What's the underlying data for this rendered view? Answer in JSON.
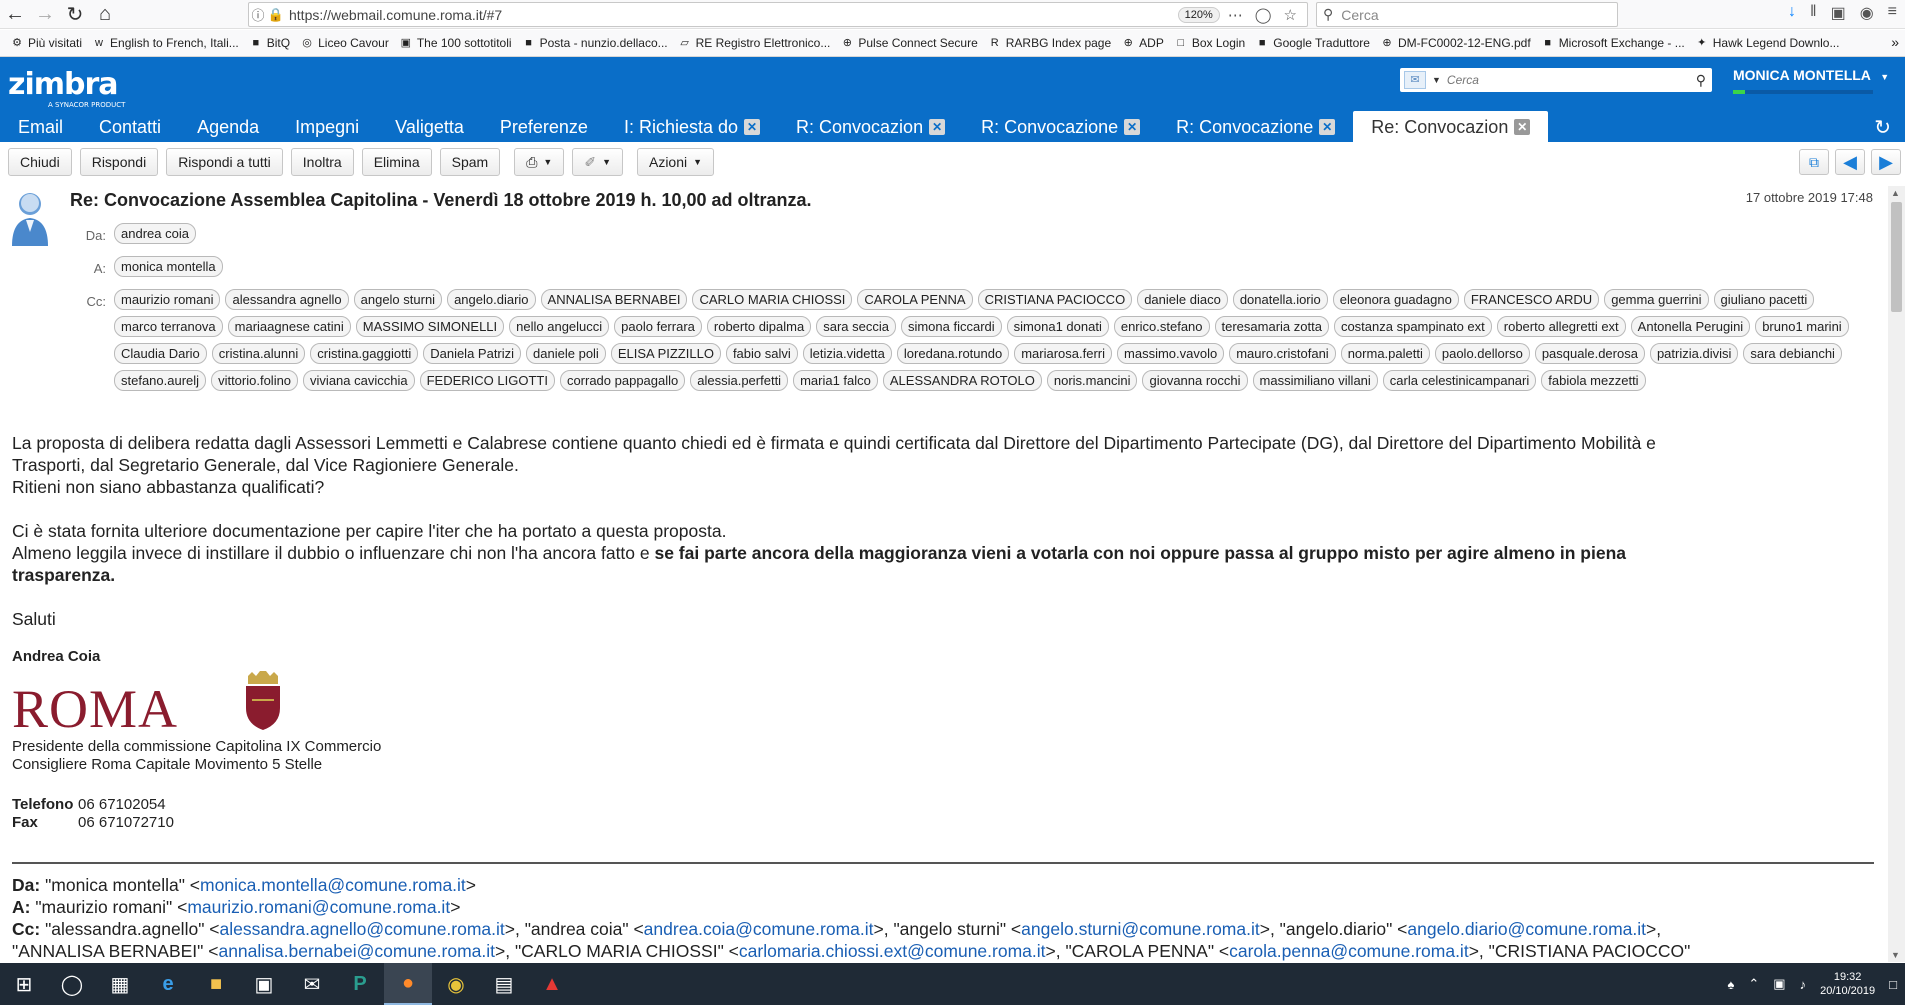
{
  "browser": {
    "url": "https://webmail.comune.roma.it/#7",
    "zoom": "120%",
    "search_placeholder": "Cerca",
    "bookmarks": [
      {
        "label": "Più visitati",
        "icon": "gear-icon"
      },
      {
        "label": "English to French, Itali...",
        "icon": "wr-icon"
      },
      {
        "label": "BitQ",
        "icon": "bitq-icon"
      },
      {
        "label": "Liceo Cavour",
        "icon": "school-icon"
      },
      {
        "label": "The 100 sottotitoli",
        "icon": "film-icon"
      },
      {
        "label": "Posta - nunzio.dellaco...",
        "icon": "outlook-icon"
      },
      {
        "label": "RE Registro Elettronico...",
        "icon": "folder-icon"
      },
      {
        "label": "Pulse Connect Secure",
        "icon": "globe-icon"
      },
      {
        "label": "RARBG Index page",
        "icon": "r-icon"
      },
      {
        "label": "ADP",
        "icon": "globe-icon"
      },
      {
        "label": "Box Login",
        "icon": "box-icon"
      },
      {
        "label": "Google Traduttore",
        "icon": "translate-icon"
      },
      {
        "label": "DM-FC0002-12-ENG.pdf",
        "icon": "globe-icon"
      },
      {
        "label": "Microsoft Exchange - ...",
        "icon": "exchange-icon"
      },
      {
        "label": "Hawk Legend Downlo...",
        "icon": "hawk-icon"
      }
    ]
  },
  "zimbra": {
    "logo": "zimbra",
    "logo_sub": "A SYNACOR PRODUCT",
    "search_placeholder": "Cerca",
    "user": "MONICA MONTELLA",
    "tabs": [
      {
        "label": "Email",
        "closable": false,
        "active": false
      },
      {
        "label": "Contatti",
        "closable": false,
        "active": false
      },
      {
        "label": "Agenda",
        "closable": false,
        "active": false
      },
      {
        "label": "Impegni",
        "closable": false,
        "active": false
      },
      {
        "label": "Valigetta",
        "closable": false,
        "active": false
      },
      {
        "label": "Preferenze",
        "closable": false,
        "active": false
      },
      {
        "label": "I: Richiesta do",
        "closable": true,
        "active": false
      },
      {
        "label": "R: Convocazion",
        "closable": true,
        "active": false
      },
      {
        "label": "R: Convocazione",
        "closable": true,
        "active": false
      },
      {
        "label": "R: Convocazione",
        "closable": true,
        "active": false
      },
      {
        "label": "Re: Convocazion",
        "closable": true,
        "active": true
      }
    ],
    "toolbar": {
      "close": "Chiudi",
      "reply": "Rispondi",
      "reply_all": "Rispondi a tutti",
      "forward": "Inoltra",
      "delete": "Elimina",
      "spam": "Spam",
      "actions": "Azioni"
    }
  },
  "message": {
    "subject": "Re: Convocazione Assemblea Capitolina - Venerdì 18 ottobre 2019 h. 10,00 ad oltranza.",
    "date": "17 ottobre 2019 17:48",
    "from_label": "Da:",
    "to_label": "A:",
    "cc_label": "Cc:",
    "from": [
      "andrea coia"
    ],
    "to": [
      "monica montella"
    ],
    "cc": [
      "maurizio romani",
      "alessandra agnello",
      "angelo sturni",
      "angelo.diario",
      "ANNALISA BERNABEI",
      "CARLO MARIA CHIOSSI",
      "CAROLA PENNA",
      "CRISTIANA PACIOCCO",
      "daniele diaco",
      "donatella.iorio",
      "eleonora guadagno",
      "FRANCESCO ARDU",
      "gemma guerrini",
      "giuliano pacetti",
      "marco terranova",
      "mariaagnese catini",
      "MASSIMO SIMONELLI",
      "nello angelucci",
      "paolo ferrara",
      "roberto dipalma",
      "sara seccia",
      "simona ficcardi",
      "simona1 donati",
      "enrico.stefano",
      "teresamaria zotta",
      "costanza spampinato ext",
      "roberto allegretti ext",
      "Antonella Perugini",
      "bruno1 marini",
      "Claudia Dario",
      "cristina.alunni",
      "cristina.gaggiotti",
      "Daniela Patrizi",
      "daniele poli",
      "ELISA PIZZILLO",
      "fabio salvi",
      "letizia.videtta",
      "loredana.rotundo",
      "mariarosa.ferri",
      "massimo.vavolo",
      "mauro.cristofani",
      "norma.paletti",
      "paolo.dellorso",
      "pasquale.derosa",
      "patrizia.divisi",
      "sara debianchi",
      "stefano.aurelj",
      "vittorio.folino",
      "viviana cavicchia",
      "FEDERICO LIGOTTI",
      "corrado pappagallo",
      "alessia.perfetti",
      "maria1 falco",
      "ALESSANDRA ROTOLO",
      "noris.mancini",
      "giovanna rocchi",
      "massimiliano villani",
      "carla celestinicampanari",
      "fabiola mezzetti"
    ],
    "body": {
      "p1a": "La proposta di delibera redatta dagli Assessori Lemmetti e Calabrese contiene quanto chiedi ed è firmata e quindi certificata dal Direttore del Dipartimento Partecipate (DG), dal Direttore del Dipartimento Mobilità e",
      "p1b": "Trasporti, dal Segretario Generale, dal Vice Ragioniere Generale.",
      "p1c": "Ritieni non siano abbastanza qualificati?",
      "p2a": "Ci è stata fornita ulteriore documentazione per capire l'iter che ha portato a questa proposta.",
      "p2b": "Almeno leggila invece di instillare il dubbio o influenzare chi non l'ha ancora fatto e ",
      "p2b_bold": "se fai parte ancora della maggioranza vieni a votarla con noi oppure passa al gruppo misto per agire almeno in piena",
      "p2c_bold": "trasparenza.",
      "greeting": "Saluti"
    },
    "signature": {
      "name": "Andrea Coia",
      "logo": "ROMA",
      "role1": "Presidente della commissione Capitolina IX Commercio",
      "role2": "Consigliere Roma Capitale Movimento 5 Stelle",
      "tel_label": "Telefono",
      "tel": "06 67102054",
      "fax_label": "Fax",
      "fax": "06 671072710"
    },
    "quoted": {
      "da_label": "Da:",
      "da_name": " \"monica montella\" <",
      "da_email": "monica.montella@comune.roma.it",
      "a_label": "A:",
      "a_name": " \"maurizio romani\" <",
      "a_email": "maurizio.romani@comune.roma.it",
      "cc_label": "Cc:",
      "cc1_name": " \"alessandra.agnello\" <",
      "cc1_email": "alessandra.agnello@comune.roma.it",
      "cc2_name": ">, \"andrea coia\" <",
      "cc2_email": "andrea.coia@comune.roma.it",
      "cc3_name": ">, \"angelo sturni\" <",
      "cc3_email": "angelo.sturni@comune.roma.it",
      "cc4_name": ">, \"angelo.diario\" <",
      "cc4_email": "angelo.diario@comune.roma.it",
      "cc4_end": ">,",
      "cc5_name": "\"ANNALISA BERNABEI\" <",
      "cc5_email": "annalisa.bernabei@comune.roma.it",
      "cc6_name": ">, \"CARLO MARIA CHIOSSI\" <",
      "cc6_email": "carlomaria.chiossi.ext@comune.roma.it",
      "cc7_name": ">, \"CAROLA PENNA\" <",
      "cc7_email": "carola.penna@comune.roma.it",
      "cc8_name": ">, \"CRISTIANA PACIOCCO\""
    }
  },
  "taskbar": {
    "time": "19:32",
    "date": "20/10/2019"
  },
  "colors": {
    "zimbra_blue": "#0a6ec8",
    "link": "#1a5fb4",
    "roma_red": "#8a1c2e"
  }
}
